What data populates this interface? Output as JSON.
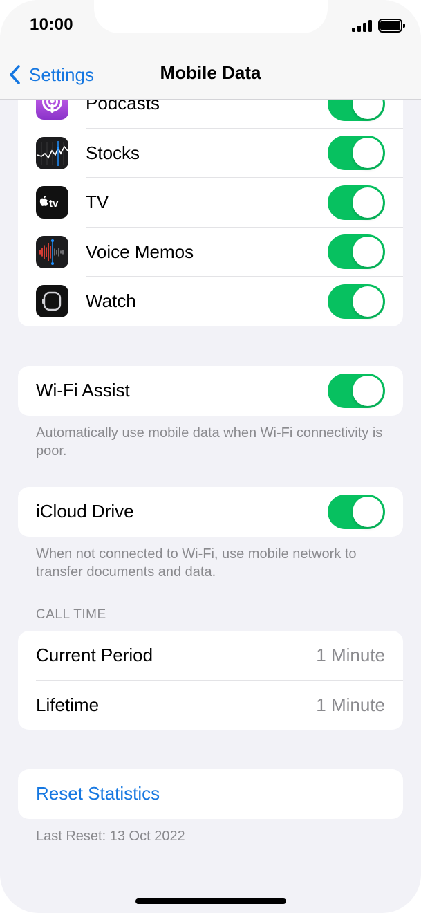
{
  "status": {
    "time": "10:00"
  },
  "nav": {
    "back_label": "Settings",
    "title": "Mobile Data"
  },
  "apps": [
    {
      "label": "Podcasts",
      "icon": "podcasts-icon",
      "enabled": true
    },
    {
      "label": "Stocks",
      "icon": "stocks-icon",
      "enabled": true
    },
    {
      "label": "TV",
      "icon": "tv-icon",
      "enabled": true
    },
    {
      "label": "Voice Memos",
      "icon": "voice-memos-icon",
      "enabled": true
    },
    {
      "label": "Watch",
      "icon": "watch-icon",
      "enabled": true
    }
  ],
  "wifi_assist": {
    "label": "Wi-Fi Assist",
    "enabled": true,
    "footer": "Automatically use mobile data when Wi-Fi connectivity is poor."
  },
  "icloud_drive": {
    "label": "iCloud Drive",
    "enabled": true,
    "footer": "When not connected to Wi-Fi, use mobile network to transfer documents and data."
  },
  "call_time": {
    "header": "CALL TIME",
    "rows": [
      {
        "label": "Current Period",
        "value": "1 Minute"
      },
      {
        "label": "Lifetime",
        "value": "1 Minute"
      }
    ]
  },
  "reset": {
    "label": "Reset Statistics",
    "footer": "Last Reset: 13 Oct 2022"
  },
  "colors": {
    "accent": "#1577e1",
    "toggle_on": "#07c160",
    "background": "#f2f2f7"
  }
}
